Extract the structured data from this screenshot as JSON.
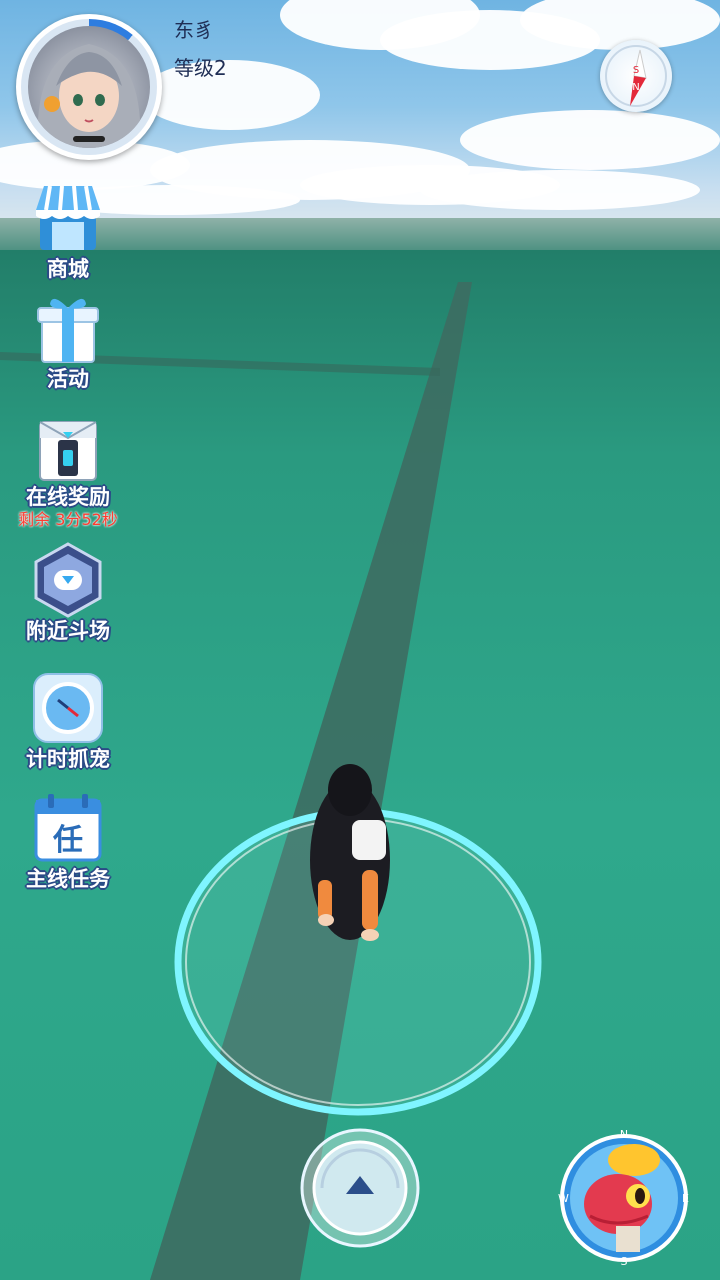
{
  "player": {
    "name": "东豸",
    "level_label": "等级2"
  },
  "menu": [
    {
      "id": "shop",
      "label": "商城",
      "icon": "shop-icon"
    },
    {
      "id": "events",
      "label": "活动",
      "icon": "gift-icon"
    },
    {
      "id": "online-reward",
      "label": "在线奖励",
      "sub": "剩余 3分52秒",
      "icon": "reward-box-icon"
    },
    {
      "id": "nearby-arena",
      "label": "附近斗场",
      "icon": "arena-icon"
    },
    {
      "id": "timed-catch",
      "label": "计时抓宠",
      "icon": "timer-icon"
    },
    {
      "id": "main-quest",
      "label": "主线任务",
      "icon": "quest-calendar-icon",
      "glyph": "任"
    }
  ],
  "compass": {
    "n": "N",
    "s": "S",
    "w": "W",
    "e": "E"
  },
  "colors": {
    "label_outline": "#2a4a86",
    "timer_red": "#ff3b30",
    "ring_cyan": "#7ff5ff",
    "ground": "#2aa286"
  }
}
